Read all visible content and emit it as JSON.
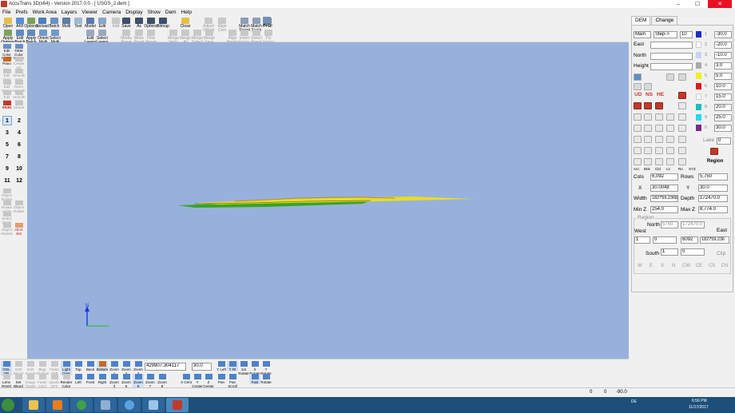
{
  "window": {
    "title": "AccuTrans 3D(x64) - Version 2017.0.0 - [ USGS_2.dem ]",
    "controls": [
      "–",
      "☐",
      "✕"
    ]
  },
  "menu": [
    "File",
    "Prefs",
    "Work Area",
    "Layers",
    "Viewer",
    "Camera",
    "Display",
    "Show",
    "Dem",
    "Help"
  ],
  "toolbar": {
    "row1": [
      "Open",
      "AKF",
      "Options",
      "Reload",
      "Batch",
      "Multi",
      "Text",
      "Model",
      "Edit",
      "Add",
      "Save",
      "As",
      "Options",
      "Bitmap",
      "Close",
      "Adjust Object",
      "Align Cam",
      "Match Target",
      "Match Scale",
      "Pt Of",
      "Help"
    ],
    "row2": [
      "Apply Options Model",
      "Edit Batch",
      "Apply Batch",
      "Orient Multi",
      "Select Multi",
      "Edit Layers",
      "Select Layers",
      "Media Reset",
      "Make Reset",
      "Flow Reset",
      "Merge Verts",
      "Merge All",
      "Merge Select",
      "Merge Save",
      "Align Norms",
      "Invert Faces",
      "Select Reset",
      "Fix Faces"
    ]
  },
  "left_panel": {
    "tools": [
      "Edit Color Image",
      "DEM Color Image",
      "Pano",
      "Create UV",
      "Edit Verts",
      "Smooth Verts",
      "Edit Norms",
      "Norm Smooth",
      "Edit Selct",
      "Smooth Selct",
      "VR3D",
      "Virtual"
    ],
    "numbers": [
      "1",
      "2",
      "3",
      "4",
      "5",
      "6",
      "7",
      "8",
      "9",
      "10",
      "11",
      "12"
    ],
    "selected": "1",
    "lower_tools": [
      "Object Rotate",
      "Rotate Lights",
      "Object Rotate",
      "Select Mode",
      "Object Models",
      "short dist"
    ]
  },
  "right_panel": {
    "tabs": [
      "DEM",
      "Change"
    ],
    "selected_tab": "DEM",
    "main": {
      "value": "Main",
      "step": "Step->",
      "step_value": "10"
    },
    "coords": [
      {
        "label": "East",
        "value": ""
      },
      {
        "label": "North",
        "value": ""
      },
      {
        "label": "Height",
        "value": ""
      }
    ],
    "color_levels": [
      {
        "num": "1",
        "value": "-30.0",
        "color": "#1a2fc6"
      },
      {
        "num": "2",
        "value": "-20.0",
        "color": "#ffffff"
      },
      {
        "num": "3",
        "value": "-10.0",
        "color": "#c9d2f2"
      },
      {
        "num": "4",
        "value": "3.0",
        "color": "#aaaaaa"
      },
      {
        "num": "5",
        "value": "5.0",
        "color": "#f0ef1d"
      },
      {
        "num": "6",
        "value": "10.0",
        "color": "#e0161b"
      },
      {
        "num": "7",
        "value": "15.0",
        "color": "#ffffff"
      },
      {
        "num": "8",
        "value": "20.0",
        "color": "#16bfbf"
      },
      {
        "num": "9",
        "value": "25.0",
        "color": "#2ad6e8"
      },
      {
        "num": "0",
        "value": "30.0",
        "color": "#7a2a86"
      }
    ],
    "tool_labels": [
      "UD",
      "NS",
      "HE"
    ],
    "lake_label": "Lake",
    "lake_value": "0",
    "region_label": "Region",
    "bottom_icons": [
      "Acc",
      "Bnk",
      "Cld",
      "Ls",
      "Ro",
      "XYZ"
    ],
    "info": {
      "cols_label": "Cols",
      "cols": "6,092",
      "rows_label": "Rows",
      "rows": "5,750",
      "x_label": "X",
      "x": "30.0048",
      "y_label": "Y",
      "y": "30.0",
      "width_label": "Width",
      "width": "182759.2368",
      "depth_label": "Depth",
      "depth": "172470.0",
      "minz_label": "Min Z",
      "minz": "254.0",
      "maxz_label": "Max Z",
      "maxz": "8,774.0"
    },
    "region_box": {
      "title": "Region",
      "north_label": "North",
      "north_a": "5750",
      "north_b": "172470.0",
      "west_label": "West",
      "east_label": "East",
      "west_a": "1",
      "west_b": "0",
      "east_a": "6092",
      "east_b": "182759.236",
      "south_label": "South",
      "south_a": "1",
      "south_b": "0",
      "clip_label": "Clip",
      "dirs": [
        "W",
        "E",
        "S",
        "N",
        "CW",
        "CE",
        "CS",
        "CN"
      ]
    }
  },
  "bottom_toolbar": {
    "row1": [
      "OGL ON",
      "Edit Bkgrd",
      "Edit Image",
      "Bkgr Shadow",
      "Fader OFF",
      "Light Over",
      "Top",
      "Back",
      "Bottom",
      "Zoom 1",
      "Zoom 2",
      "Zoom 3"
    ],
    "row2": [
      "Lens Reset",
      "Set Bkgrd",
      "Image Toggle",
      "Fader Color",
      "Quads OFF",
      "Render Color",
      "Left",
      "Front",
      "Right",
      "Zoom 4",
      "Zoom 5",
      "Zoom 6",
      "Zoom 7",
      "Zoom 8"
    ],
    "coord_value": "429907.304117",
    "angle_value": "30.0",
    "right_row1": [
      "Y Left",
      "Y Rt",
      "1st Rotate",
      "X Rotate",
      "Y Rotate",
      "Z Rotate"
    ],
    "right_row2": [
      "X Cent",
      "Y Center",
      "Z Center",
      "Pan",
      "Pan Scroll",
      "Fast",
      "Rotate"
    ]
  },
  "status": {
    "a": "0",
    "b": "0",
    "c": "-90.0"
  },
  "taskbar": {
    "clock_time": "6:56 PM",
    "clock_date": "11/17/2017",
    "lang": "DE"
  },
  "axis": {
    "label": "N"
  },
  "colors": {
    "viewport_bg": "#97b1dc",
    "terrain_yellow": "#e8dc28",
    "terrain_green": "#37a424",
    "terrain_brown": "#b88c2a"
  }
}
